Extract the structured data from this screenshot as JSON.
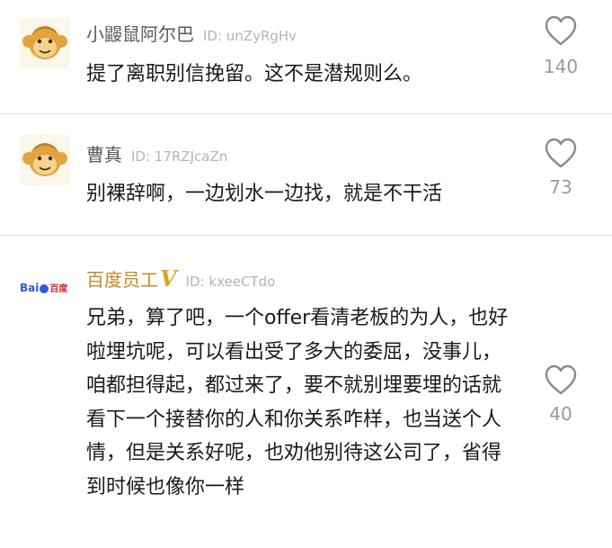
{
  "comments": [
    {
      "username": "小鼹鼠阿尔巴",
      "uid": "ID: unZyRgHv",
      "text": "提了离职别信挽留。这不是潜规则么。",
      "likes": "140",
      "avatar": "monkey-avatar",
      "vip": false
    },
    {
      "username": "曹真",
      "uid": "ID: 17RZJcaZn",
      "text": "别裸辞啊，一边划水一边找，就是不干活",
      "likes": "73",
      "avatar": "monkey-avatar",
      "vip": false
    },
    {
      "username": "百度员工",
      "vip_mark": "V",
      "uid": "ID: kxeeCTdo",
      "text": "兄弟，算了吧，一个offer看清老板的为人，也好啦埋坑呢，可以看出受了多大的委屈，没事儿，咱都担得起，都过来了，要不就别埋要埋的话就看下一个接替你的人和你关系咋样，也当送个人情，但是关系好呢，也劝他别待这公司了，省得到时候也像你一样",
      "likes": "40",
      "avatar": "baidu-logo",
      "logo_text": "Bai度 百度",
      "vip": true
    }
  ],
  "colors": {
    "username": "#5a5a5a",
    "vip_username": "#c48a2a",
    "vip_badge": "#e0a020",
    "uid": "#b4b4b4",
    "text": "#1a1a1a",
    "like_count": "#9a9a9a",
    "heart_stroke": "#8a8a8a",
    "divider": "#e4e4e4"
  },
  "icons": {
    "like": "heart-outline-icon"
  }
}
